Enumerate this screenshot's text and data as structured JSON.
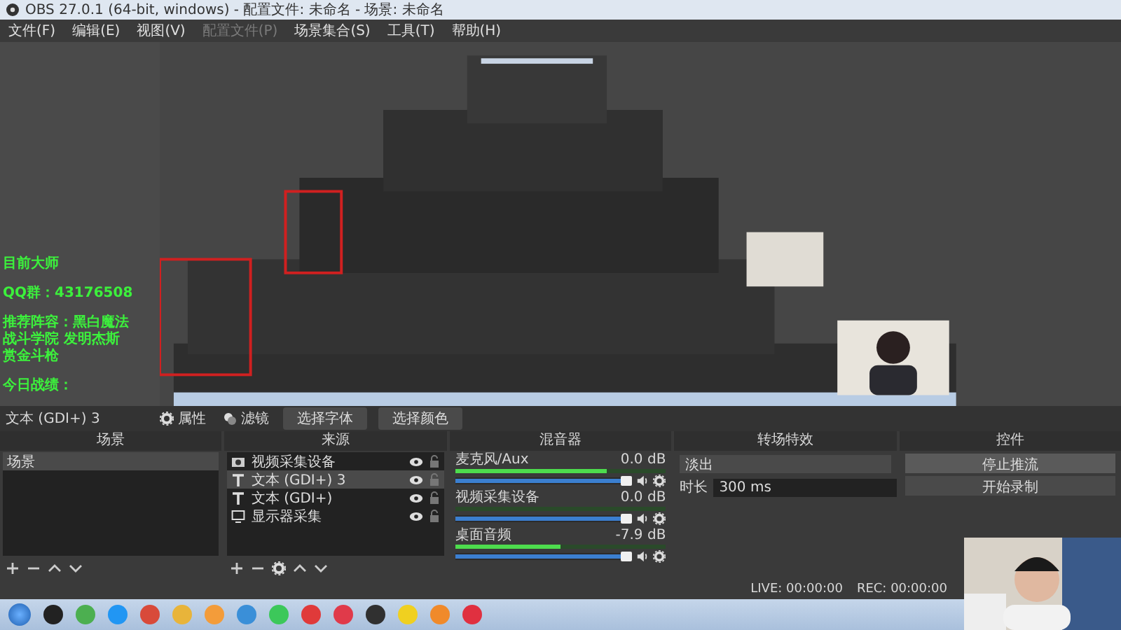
{
  "window": {
    "title": "OBS 27.0.1 (64-bit, windows) - 配置文件: 未命名 - 场景: 未命名"
  },
  "menu": [
    {
      "label": "文件(F)",
      "disabled": false
    },
    {
      "label": "编辑(E)",
      "disabled": false
    },
    {
      "label": "视图(V)",
      "disabled": false
    },
    {
      "label": "配置文件(P)",
      "disabled": true
    },
    {
      "label": "场景集合(S)",
      "disabled": false
    },
    {
      "label": "工具(T)",
      "disabled": false
    },
    {
      "label": "帮助(H)",
      "disabled": false
    }
  ],
  "preview": {
    "kind": "picture",
    "overlay_blocks": [
      [
        "目前大师"
      ],
      [
        "QQ群：43176508"
      ],
      [
        "推荐阵容：黑白魔法",
        "战斗学院 发明杰斯",
        "赏金斗枪"
      ],
      [
        "今日战绩："
      ]
    ]
  },
  "source_toolbar": {
    "source_name": "文本 (GDI+) 3",
    "buttons": [
      {
        "label": "属性",
        "kind": "properties"
      },
      {
        "label": "滤镜",
        "kind": "filters"
      },
      {
        "label": "选择字体",
        "kind": "plain"
      },
      {
        "label": "选择颜色",
        "kind": "plain"
      }
    ]
  },
  "scenes": {
    "title": "场景",
    "items": [
      {
        "label": "场景",
        "selected": true
      }
    ]
  },
  "sources": {
    "title": "来源",
    "items": [
      {
        "label": "视频采集设备",
        "kind": "camera",
        "selected": false,
        "visible": true,
        "locked": false
      },
      {
        "label": "文本 (GDI+) 3",
        "kind": "text",
        "selected": true,
        "visible": true,
        "locked": false
      },
      {
        "label": "文本 (GDI+)",
        "kind": "text",
        "selected": false,
        "visible": true,
        "locked": false
      },
      {
        "label": "显示器采集",
        "kind": "monitor",
        "selected": false,
        "visible": true,
        "locked": false
      }
    ]
  },
  "mixer": {
    "title": "混音器",
    "channels": [
      {
        "name": "麦克风/Aux",
        "reading": "0.0 dB",
        "meter": {
          "level": 0.72
        },
        "level": 1
      },
      {
        "name": "视频采集设备",
        "reading": "0.0 dB",
        "level": 1
      },
      {
        "name": "桌面音频",
        "reading": "-7.9 dB",
        "meter": {
          "level": 0.5
        },
        "level": 1
      }
    ]
  },
  "transitions": {
    "title": "转场特效",
    "selected": "淡出",
    "duration_label": "时长",
    "duration": "300 ms"
  },
  "controls": {
    "title": "控件",
    "buttons": [
      "停止推流",
      "开始录制"
    ]
  },
  "status_bar": {
    "live": "LIVE: 00:00:00",
    "rec": "REC: 00:00:00"
  },
  "taskbar": {
    "apps": [
      {
        "color": "#222222"
      },
      {
        "color": "#4caf50"
      },
      {
        "color": "#2196f3"
      },
      {
        "color": "#d84a3a"
      },
      {
        "color": "#e8b43a"
      },
      {
        "color": "#f39c3a"
      },
      {
        "color": "#3a8fd8"
      },
      {
        "color": "#3cc85a"
      },
      {
        "color": "#e03a3a"
      },
      {
        "color": "#e03a4a"
      },
      {
        "color": "#303030"
      },
      {
        "color": "#f0d020"
      },
      {
        "color": "#f08a2a"
      },
      {
        "color": "#e03040"
      }
    ]
  }
}
